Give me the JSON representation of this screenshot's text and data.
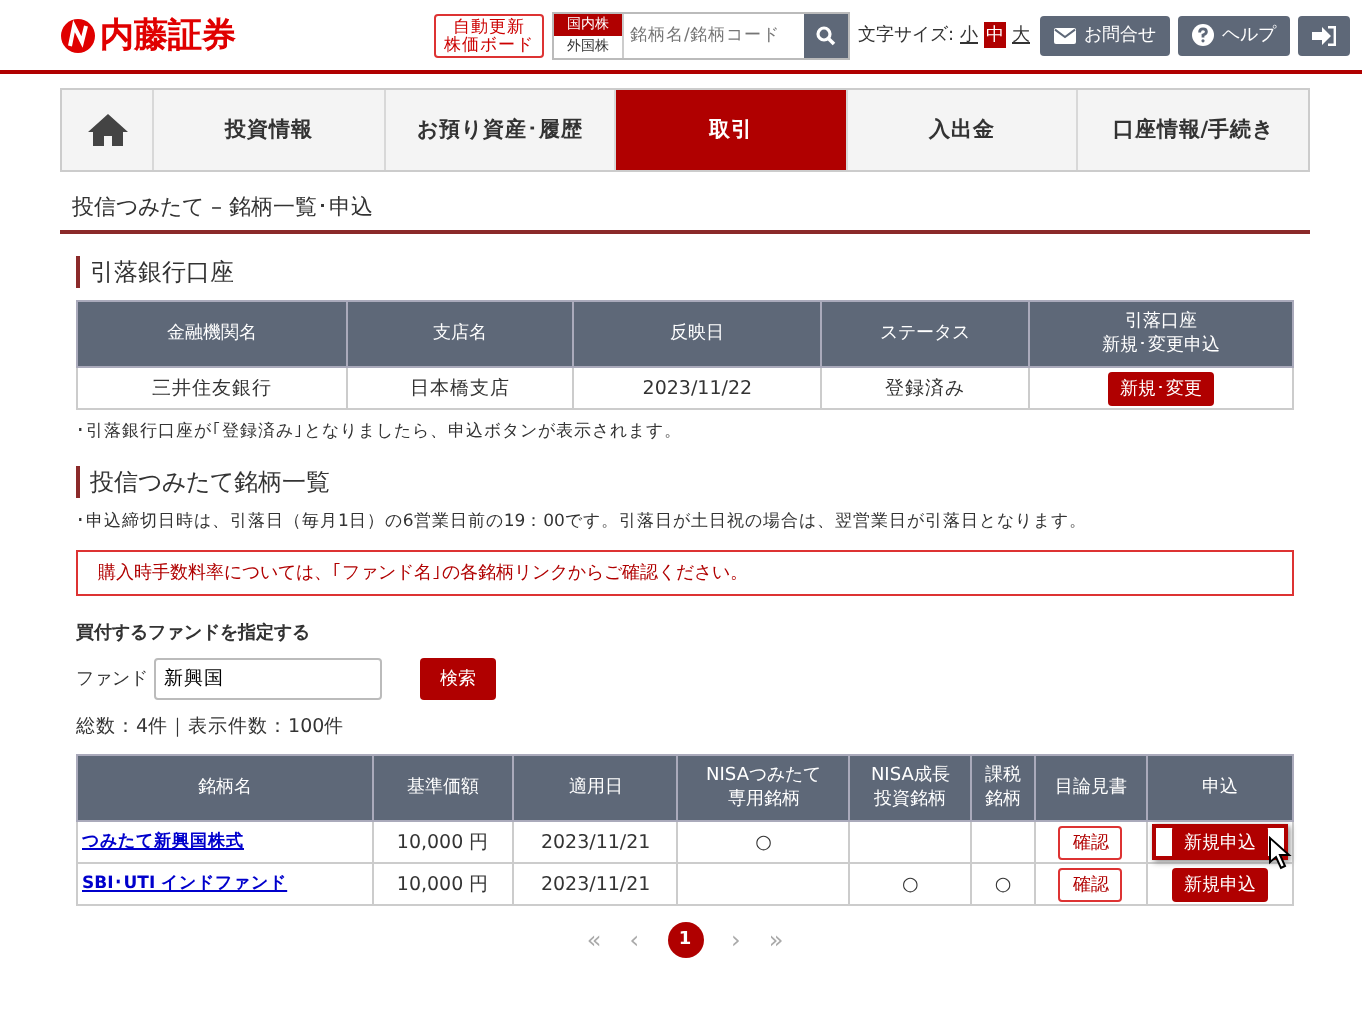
{
  "header": {
    "logo": "内藤証券",
    "board_button": [
      "自動更新",
      "株価ボード"
    ],
    "market_tabs": [
      {
        "label": "国内株",
        "selected": true
      },
      {
        "label": "外国株",
        "selected": false
      }
    ],
    "search": {
      "placeholder": "銘柄名/銘柄コード"
    },
    "font_size_label": "文字サイズ:",
    "font_sizes": [
      {
        "label": "小",
        "selected": false
      },
      {
        "label": "中",
        "selected": true
      },
      {
        "label": "大",
        "selected": false
      }
    ],
    "contact_button": "お問合せ",
    "help_button": "ヘルプ"
  },
  "nav": [
    {
      "kind": "home",
      "selected": false
    },
    {
      "label": "投資情報",
      "kind": "text",
      "selected": false
    },
    {
      "label": "お預り資産･履歴",
      "kind": "text",
      "selected": false
    },
    {
      "label": "取引",
      "kind": "text",
      "selected": true
    },
    {
      "label": "入出金",
      "kind": "text",
      "selected": false
    },
    {
      "label": "口座情報/手続き",
      "kind": "text",
      "selected": false
    }
  ],
  "page_title": "投信つみたて – 銘柄一覧･申込",
  "bank_section": {
    "heading": "引落銀行口座",
    "columns": [
      [
        "金融機関名"
      ],
      [
        "支店名"
      ],
      [
        "反映日"
      ],
      [
        "ステータス"
      ],
      [
        "引落口座",
        "新規･変更申込"
      ]
    ],
    "row": {
      "bank": "三井住友銀行",
      "branch": "日本橋支店",
      "date": "2023/11/22",
      "status": "登録済み",
      "button": "新規･変更"
    },
    "note": "･引落銀行口座が｢登録済み｣となりましたら、申込ボタンが表示されます。"
  },
  "fund_section": {
    "heading": "投信つみたて銘柄一覧",
    "note": "･申込締切日時は、引落日（毎月1日）の6営業日前の19：00です。引落日が土日祝の場合は、翌営業日が引落日となります。",
    "notice": "購入時手数料率については、｢ファンド名｣の各銘柄リンクからご確認ください。",
    "search_heading": "買付するファンドを指定する",
    "fund_label": "ファンド",
    "fund_value": "新興国",
    "search_button": "検索",
    "count": "総数：4件｜表示件数：100件",
    "columns": [
      [
        "銘柄名"
      ],
      [
        "基準価額"
      ],
      [
        "適用日"
      ],
      [
        "NISAつみたて",
        "専用銘柄"
      ],
      [
        "NISA成長",
        "投資銘柄"
      ],
      [
        "課税",
        "銘柄"
      ],
      [
        "目論見書"
      ],
      [
        "申込"
      ]
    ],
    "rows": [
      {
        "name": "つみたて新興国株式",
        "price": "10,000 円",
        "date": "2023/11/21",
        "nisa_tsumitate": "○",
        "prospectus": "確認",
        "apply": "新規申込",
        "highlighted": true
      },
      {
        "name": "SBI･UTI インドファンド",
        "price": "10,000 円",
        "date": "2023/11/21",
        "nisa_growth": "○",
        "taxable": "○",
        "prospectus": "確認",
        "apply": "新規申込",
        "highlighted": false
      }
    ],
    "pagination": {
      "first": "«",
      "prev": "‹",
      "pages": [
        {
          "label": "1",
          "selected": true
        }
      ],
      "next": "›",
      "last": "»"
    }
  }
}
